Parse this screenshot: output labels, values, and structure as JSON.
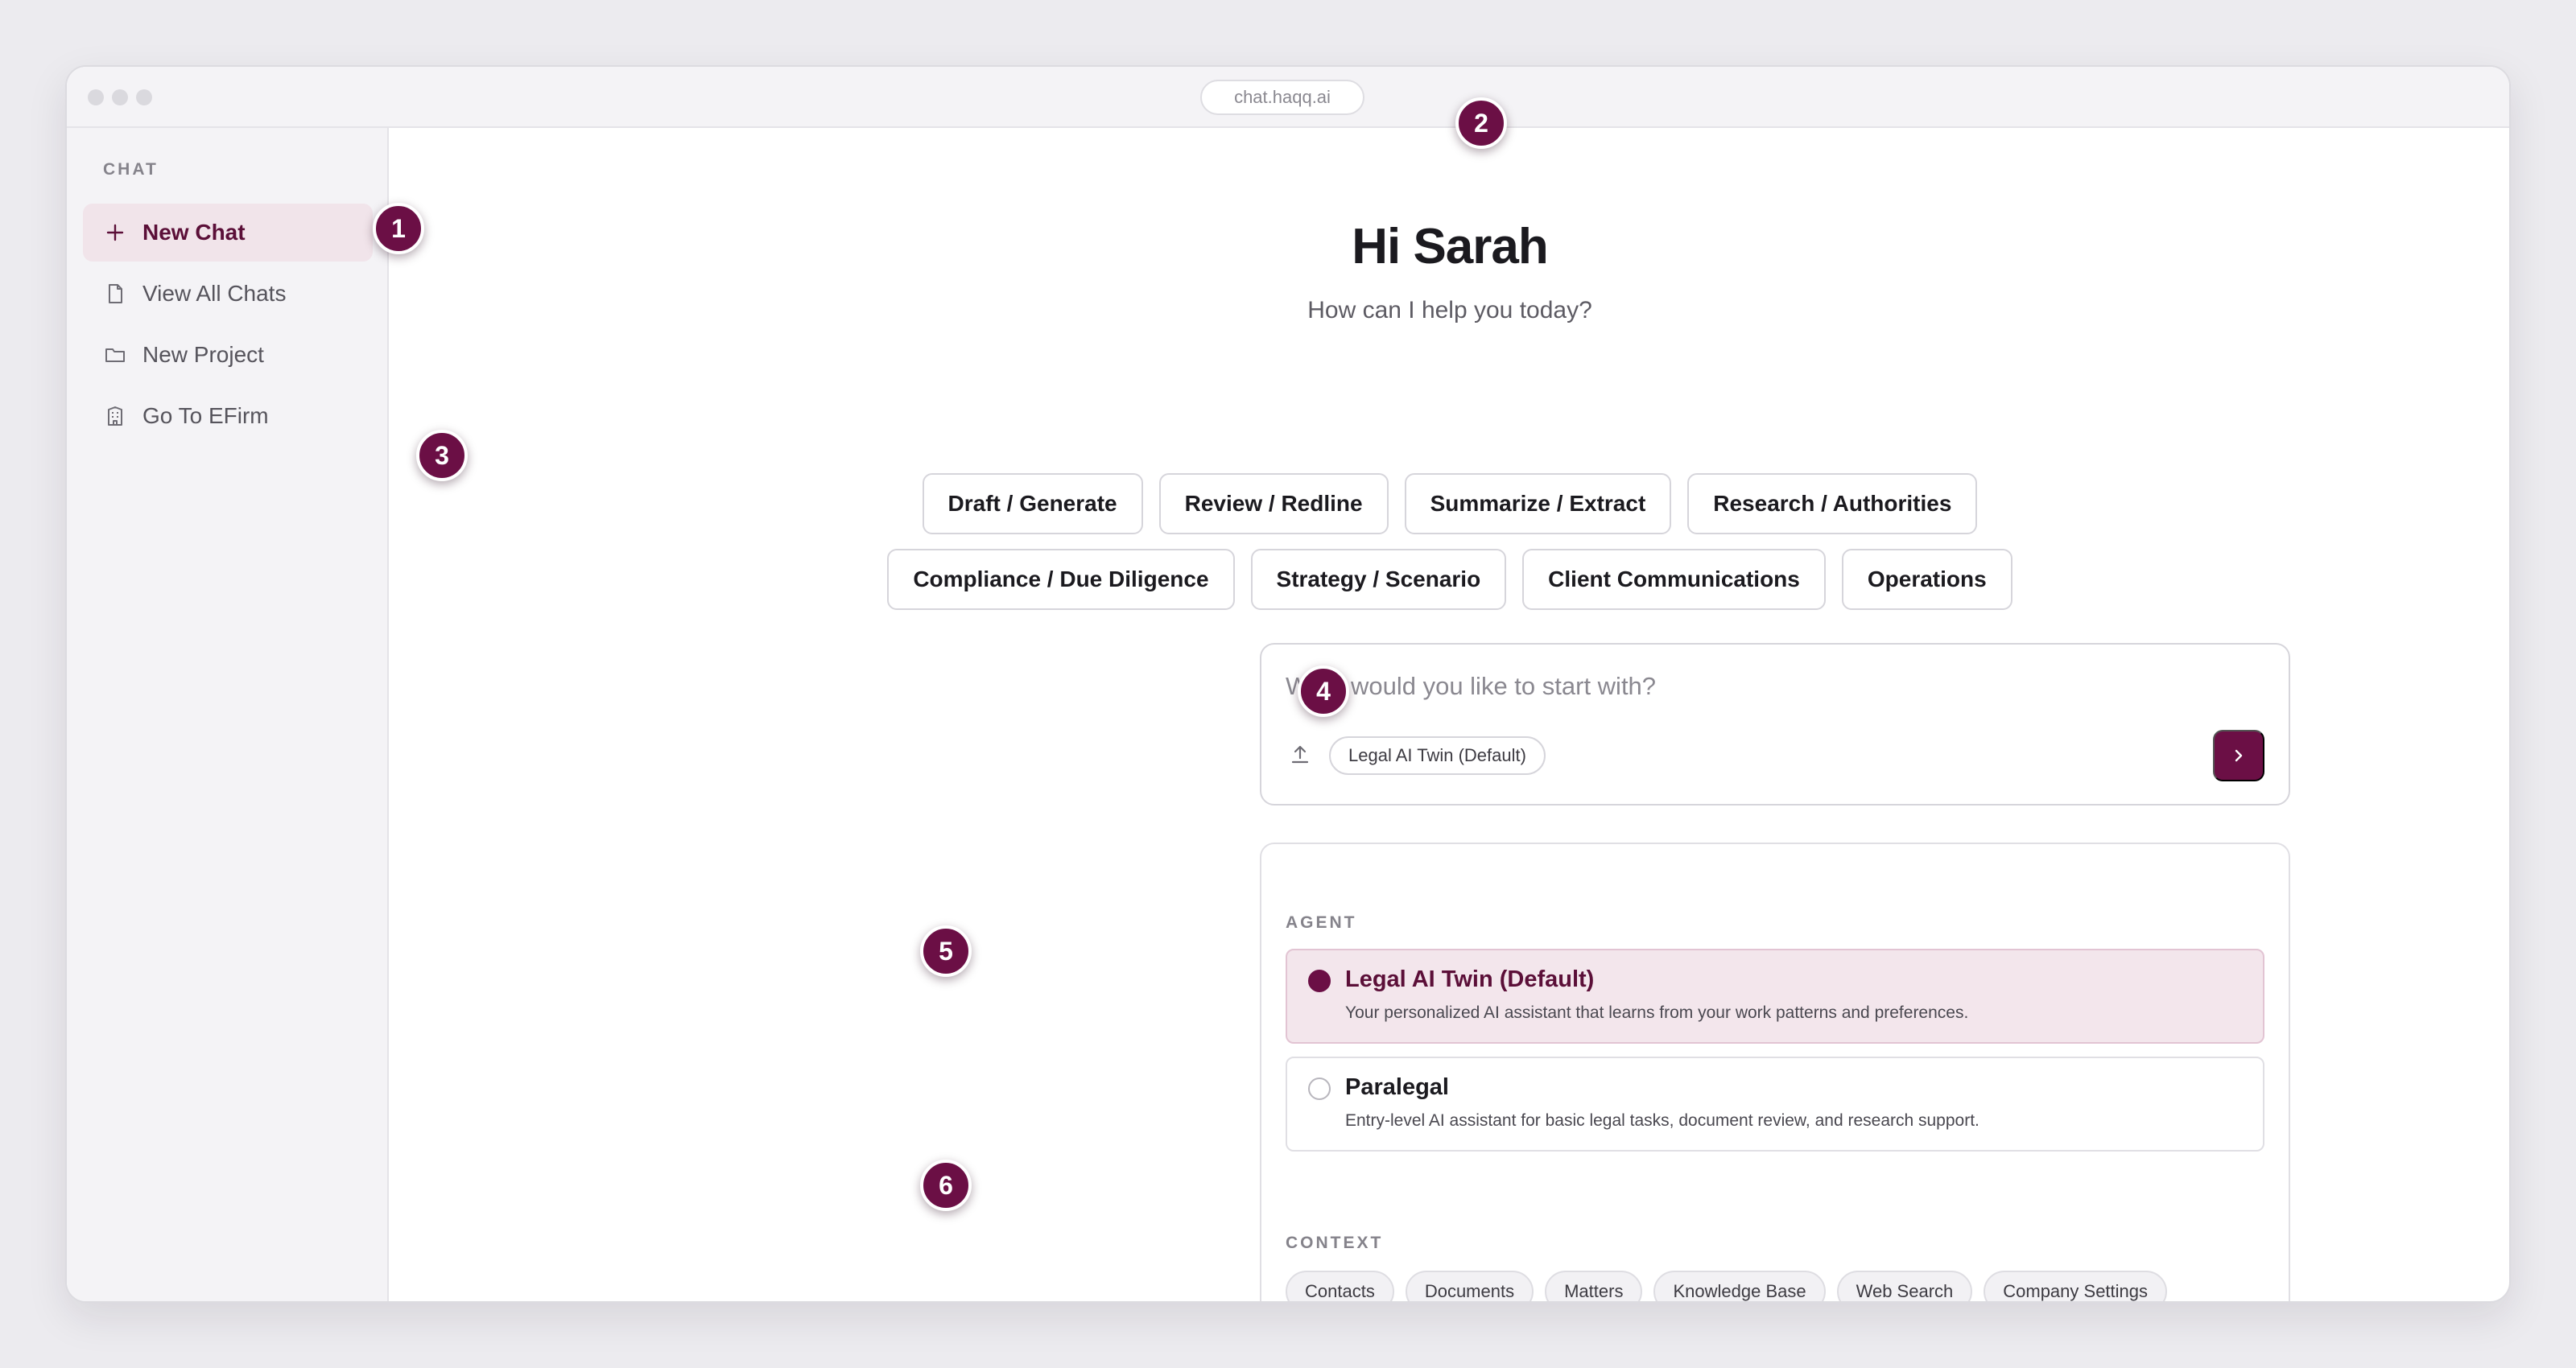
{
  "browser": {
    "url": "chat.haqq.ai"
  },
  "sidebar": {
    "heading": "CHAT",
    "items": [
      {
        "label": "New Chat",
        "icon": "plus-icon",
        "active": true
      },
      {
        "label": "View All Chats",
        "icon": "document-icon",
        "active": false
      },
      {
        "label": "New Project",
        "icon": "folder-icon",
        "active": false
      },
      {
        "label": "Go To EFirm",
        "icon": "building-icon",
        "active": false
      }
    ]
  },
  "main": {
    "greeting": "Hi Sarah",
    "subgreeting": "How can I help you today?",
    "categories_row1": [
      "Draft / Generate",
      "Review / Redline",
      "Summarize / Extract",
      "Research / Authorities"
    ],
    "categories_row2": [
      "Compliance / Due Diligence",
      "Strategy / Scenario",
      "Client Communications",
      "Operations"
    ],
    "composer": {
      "placeholder": "What would you like to start with?",
      "agent_pill": "Legal AI Twin (Default)",
      "upload_icon": "upload-icon",
      "send_icon": "chevron-right-icon"
    },
    "agent_section": {
      "heading": "AGENT",
      "agents": [
        {
          "name": "Legal AI Twin (Default)",
          "description": "Your personalized AI assistant that learns from your work patterns and preferences.",
          "selected": true
        },
        {
          "name": "Paralegal",
          "description": "Entry-level AI assistant for basic legal tasks, document review, and research support.",
          "selected": false
        }
      ]
    },
    "context_section": {
      "heading": "CONTEXT",
      "chips": [
        "Contacts",
        "Documents",
        "Matters",
        "Knowledge Base",
        "Web Search",
        "Company Settings"
      ]
    }
  },
  "callouts": [
    "1",
    "2",
    "3",
    "4",
    "5",
    "6"
  ],
  "colors": {
    "accent": "#6b0f45",
    "active_bg": "#f1e4ea",
    "sidebar_bg": "#f4f3f6",
    "page_bg": "#ecebef"
  }
}
